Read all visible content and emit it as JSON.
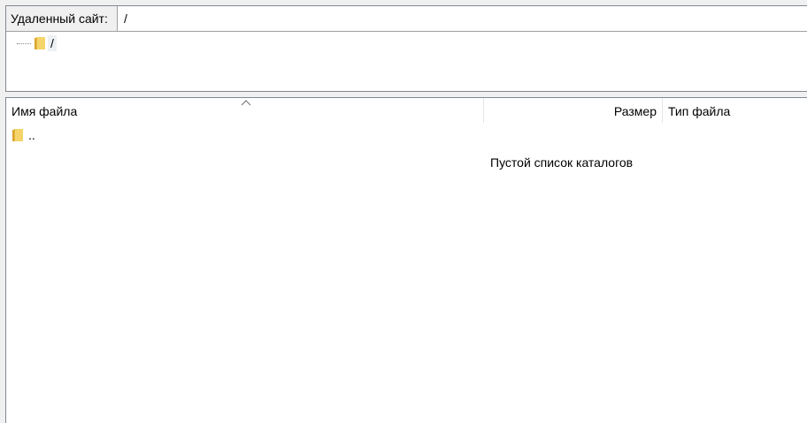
{
  "remote_site": {
    "label": "Удаленный сайт:",
    "path": "/"
  },
  "tree": {
    "root_label": "/"
  },
  "file_list": {
    "columns": {
      "name": "Имя файла",
      "size": "Размер",
      "type": "Тип файла"
    },
    "sort_column": "name",
    "sort_direction": "ascending",
    "rows": [
      {
        "name": "..",
        "icon": "folder-icon"
      }
    ],
    "empty_message": "Пустой список каталогов"
  }
}
